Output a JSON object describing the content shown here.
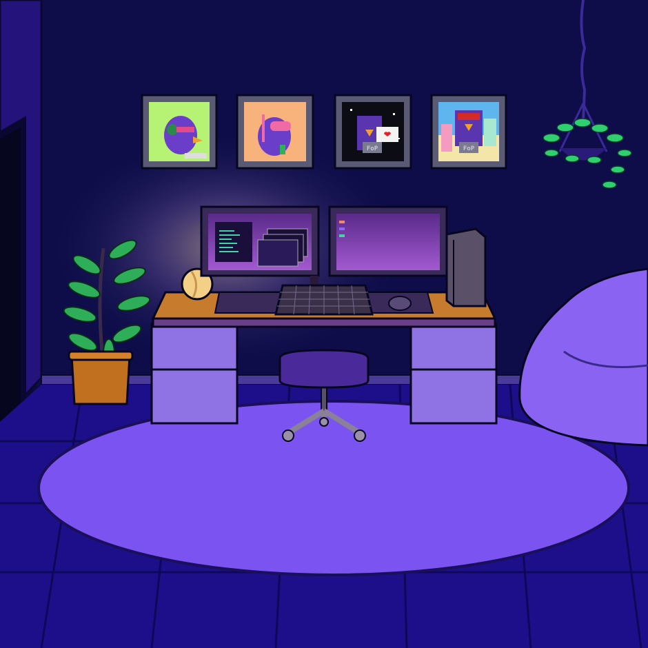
{
  "scene": {
    "palette": {
      "wall": "#0e0d4a",
      "wall_side": "#23137a",
      "floor": "#1d0f8a",
      "rug": "#7b53f0",
      "desk_top": "#c77b2c",
      "drawers": "#8f73e4",
      "bean_bag": "#8a63f2",
      "lamp_glow": "#f4cf86"
    },
    "wall_art": [
      {
        "badge": "",
        "bg": "#b6f274",
        "icon": "parrot-with-headphones"
      },
      {
        "badge": "",
        "bg": "#f7b37b",
        "icon": "parrot-with-snorkel"
      },
      {
        "badge": "FoP",
        "bg": "#0c0c14",
        "icon": "parrot-with-heart-sign"
      },
      {
        "badge": "FoP",
        "bg": "#5fb6ef",
        "icon": "parrot-in-colorful-scene"
      }
    ],
    "objects": [
      "desk-lamp",
      "dual-monitors",
      "keyboard",
      "mouse",
      "pc-tower",
      "office-chair",
      "potted-plant",
      "hanging-plant",
      "bean-bag",
      "round-rug",
      "doorway"
    ]
  }
}
